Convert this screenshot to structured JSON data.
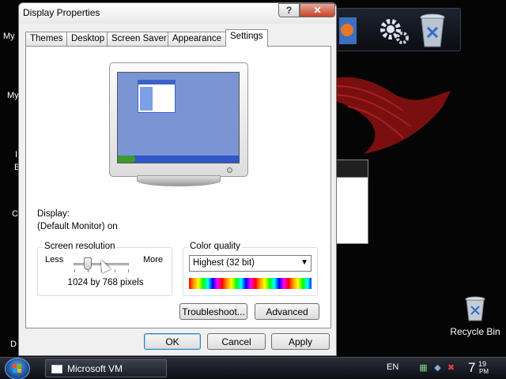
{
  "desktop": {
    "labels_left": [
      "My",
      "My",
      "I",
      "E",
      "C",
      "D"
    ],
    "recycle_bin": {
      "label": "Recycle Bin",
      "icon": "recycle-bin-icon"
    },
    "dock_icons": [
      "media-player-icon",
      "gears-icon",
      "recycle-bin-icon"
    ]
  },
  "dialog": {
    "title": "Display Properties",
    "help_glyph": "?",
    "close_glyph": "✕",
    "tabs": [
      {
        "label": "Themes"
      },
      {
        "label": "Desktop"
      },
      {
        "label": "Screen Saver"
      },
      {
        "label": "Appearance"
      },
      {
        "label": "Settings",
        "active": true
      }
    ],
    "display_label": "Display:",
    "display_value": "(Default Monitor) on",
    "screen_resolution": {
      "legend": "Screen resolution",
      "less": "Less",
      "more": "More",
      "value_text": "1024 by 768 pixels",
      "slider_position": 0.25
    },
    "color_quality": {
      "legend": "Color quality",
      "selected": "Highest (32 bit)"
    },
    "buttons": {
      "troubleshoot": "Troubleshoot...",
      "advanced": "Advanced",
      "ok": "OK",
      "cancel": "Cancel",
      "apply": "Apply"
    }
  },
  "taskbar": {
    "task_item": "Microsoft VM",
    "language": "EN",
    "clock_hour": "7",
    "clock_minute": "19",
    "clock_ampm": "PM"
  }
}
